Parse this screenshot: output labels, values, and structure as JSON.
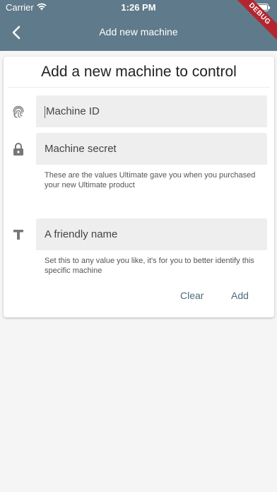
{
  "status_bar": {
    "carrier": "Carrier",
    "time": "1:26 PM"
  },
  "app_bar": {
    "title": "Add new machine",
    "debug_banner": "DEBUG"
  },
  "card": {
    "title": "Add a new machine to control",
    "fields": {
      "machine_id": {
        "placeholder": "Machine ID"
      },
      "machine_secret": {
        "placeholder": "Machine secret",
        "helper": "These are the values Ultimate gave you when you purchased your new Ultimate product"
      },
      "friendly_name": {
        "placeholder": "A friendly name",
        "helper": "Set this to any value you like, it's for you to better identify this specific machine"
      }
    },
    "buttons": {
      "clear": "Clear",
      "add": "Add"
    }
  },
  "colors": {
    "app_bar": "#5f7a8a",
    "accent": "#4d6b7b",
    "debug": "#b3262f"
  }
}
